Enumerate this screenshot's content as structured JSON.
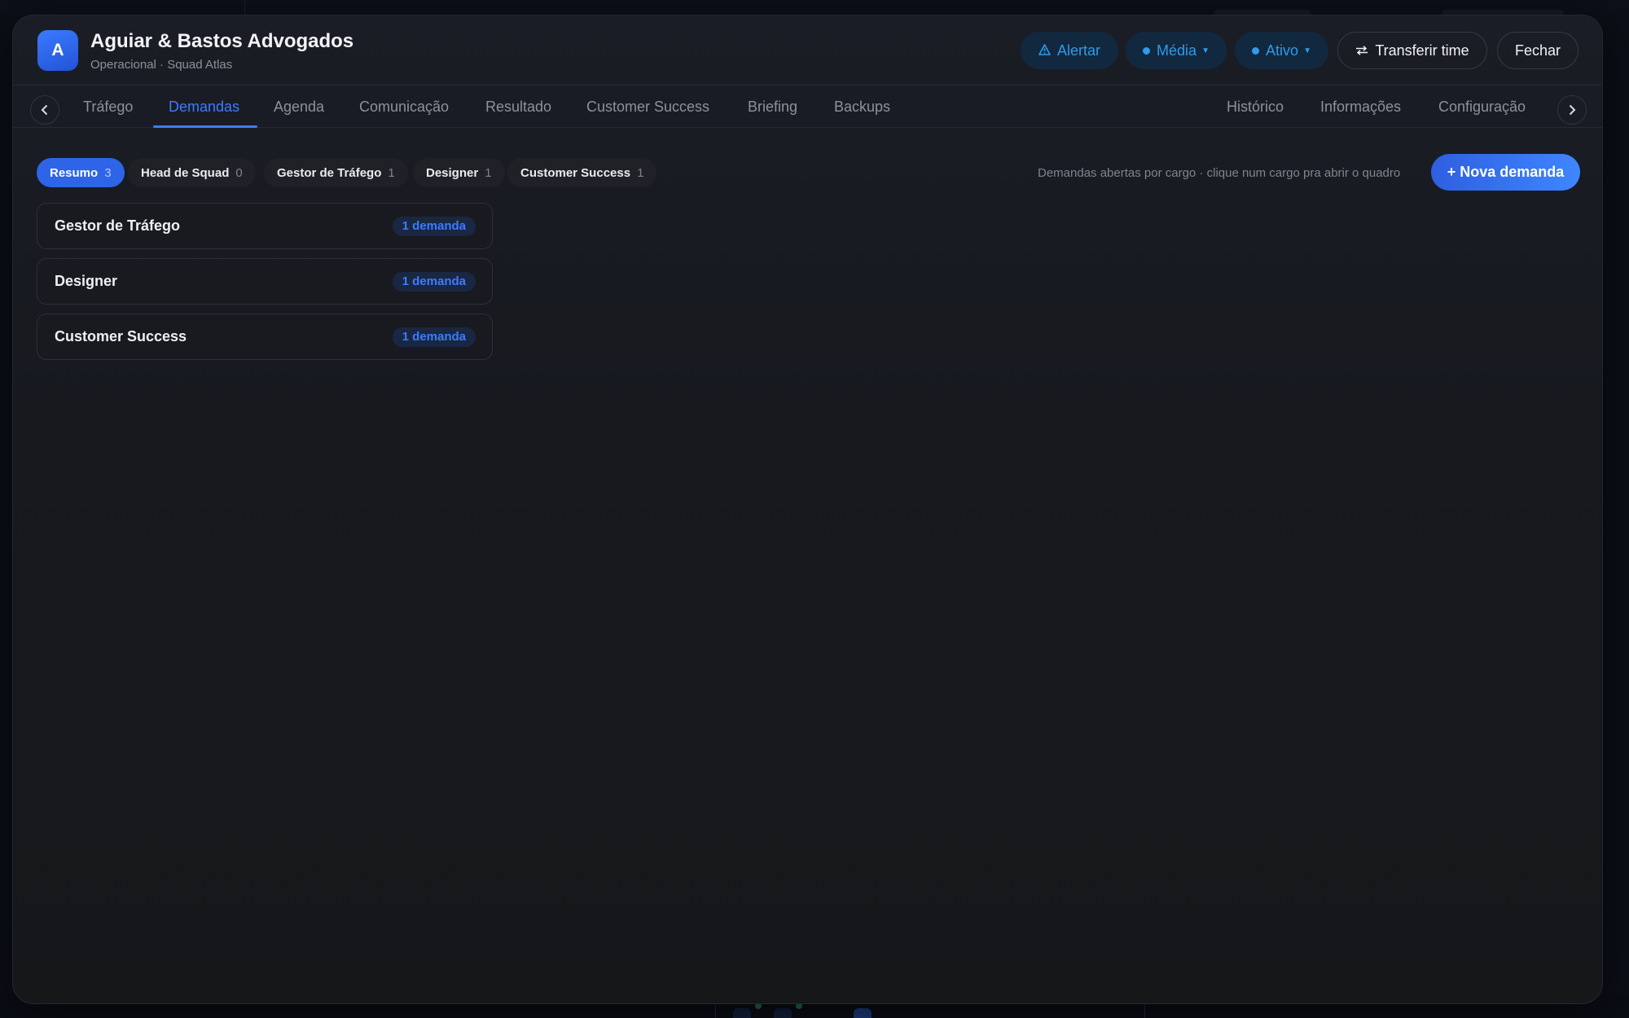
{
  "header": {
    "avatar_letter": "A",
    "title": "Aguiar & Bastos Advogados",
    "subtitle": "Operacional · Squad Atlas",
    "alert_label": "Alertar",
    "priority_label": "Média",
    "status_label": "Ativo",
    "transfer_label": "Transferir time",
    "close_label": "Fechar"
  },
  "tabs": {
    "left": [
      "Tráfego",
      "Demandas",
      "Agenda",
      "Comunicação",
      "Resultado",
      "Customer Success",
      "Briefing",
      "Backups"
    ],
    "right": [
      "Histórico",
      "Informações",
      "Configuração"
    ],
    "active": "Demandas"
  },
  "filters": [
    {
      "label": "Resumo",
      "count": "3",
      "active": true
    },
    {
      "label": "Head de Squad",
      "count": "0",
      "active": false
    },
    {
      "label": "Gestor de Tráfego",
      "count": "1",
      "active": false
    },
    {
      "label": "Designer",
      "count": "1",
      "active": false
    },
    {
      "label": "Customer Success",
      "count": "1",
      "active": false
    }
  ],
  "hint": "Demandas abertas por cargo · clique num cargo pra abrir o quadro",
  "new_demand_label": "+ Nova demanda",
  "roles": [
    {
      "name": "Gestor de Tráfego",
      "badge": "1 demanda"
    },
    {
      "name": "Designer",
      "badge": "1 demanda"
    },
    {
      "name": "Customer Success",
      "badge": "1 demanda"
    }
  ],
  "colors": {
    "accent": "#3d7bff",
    "status_blue": "#2f9bea",
    "background": "#17191f"
  },
  "icons": {
    "alert": "warning-triangle-icon",
    "transfer": "swap-arrows-icon",
    "prev": "chevron-left-icon",
    "next": "chevron-right-icon"
  }
}
